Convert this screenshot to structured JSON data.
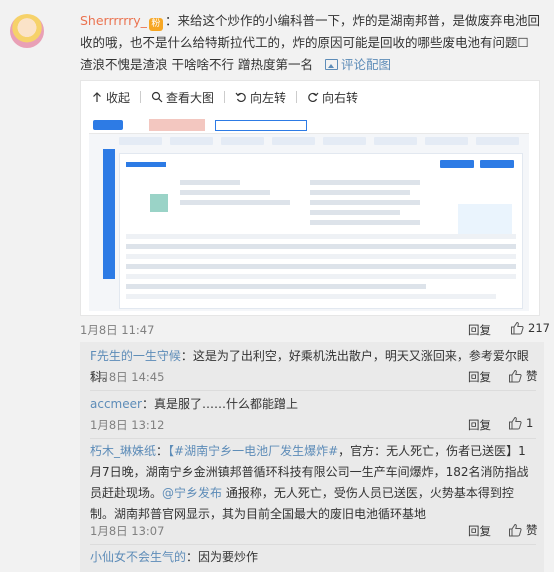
{
  "main_comment": {
    "username": "Sherrrrrry_",
    "badge": "粉",
    "text": "：来给这个炒作的小编科普一下，炸的是湖南邦普，是做废弃电池回收的哦，也不是什么给特斯拉代工的，炸的原因可能是回收的哪些废电池有问题☐ 渣浪不愧是渣浪  干啥啥不行 蹭热度第一名",
    "pic_link": "评论配图",
    "time": "1月8日 11:47",
    "reply_label": "回复",
    "likes": "217"
  },
  "image_toolbar": {
    "collapse": "收起",
    "view_large": "查看大图",
    "rotate_left": "向左转",
    "rotate_right": "向右转"
  },
  "screenshot": {
    "brand": "天眼查",
    "watermark": "@天眼查"
  },
  "replies": [
    {
      "username": "F先生的一生守候",
      "text": "：这是为了出利空，好乘机洗出散户，明天又涨回来，参考爱尔眼科。",
      "time": "1月8日 14:45",
      "reply_label": "回复",
      "likes": "赞"
    },
    {
      "username": "accmeer",
      "text": "：真是服了……什么都能蹭上",
      "time": "1月8日 13:12",
      "reply_label": "回复",
      "likes": "1"
    },
    {
      "username": "朽木_琳姝纸",
      "text_a": "：",
      "topic": "【#湖南宁乡一电池厂发生爆炸#",
      "text_b": "，官方：无人死亡，伤者已送医】1月7日晚，湖南宁乡金洲镇邦普循环科技有限公司一生产车间爆炸，182名消防指战员赶赴现场。",
      "mention": "@宁乡发布",
      "text_c": " 通报称，无人死亡，受伤人员已送医，火势基本得到控制。湖南邦普官网显示，其为目前全国最大的废旧电池循环基地",
      "time": "1月8日 13:07",
      "reply_label": "回复",
      "likes": "赞"
    },
    {
      "username": "小仙女不会生气的",
      "text": "：因为要炒作"
    }
  ],
  "colors": {
    "username": "#eb7350",
    "link": "#5d8cb8",
    "background": "#f2f2f2",
    "reply_bg": "#eaeaea"
  }
}
